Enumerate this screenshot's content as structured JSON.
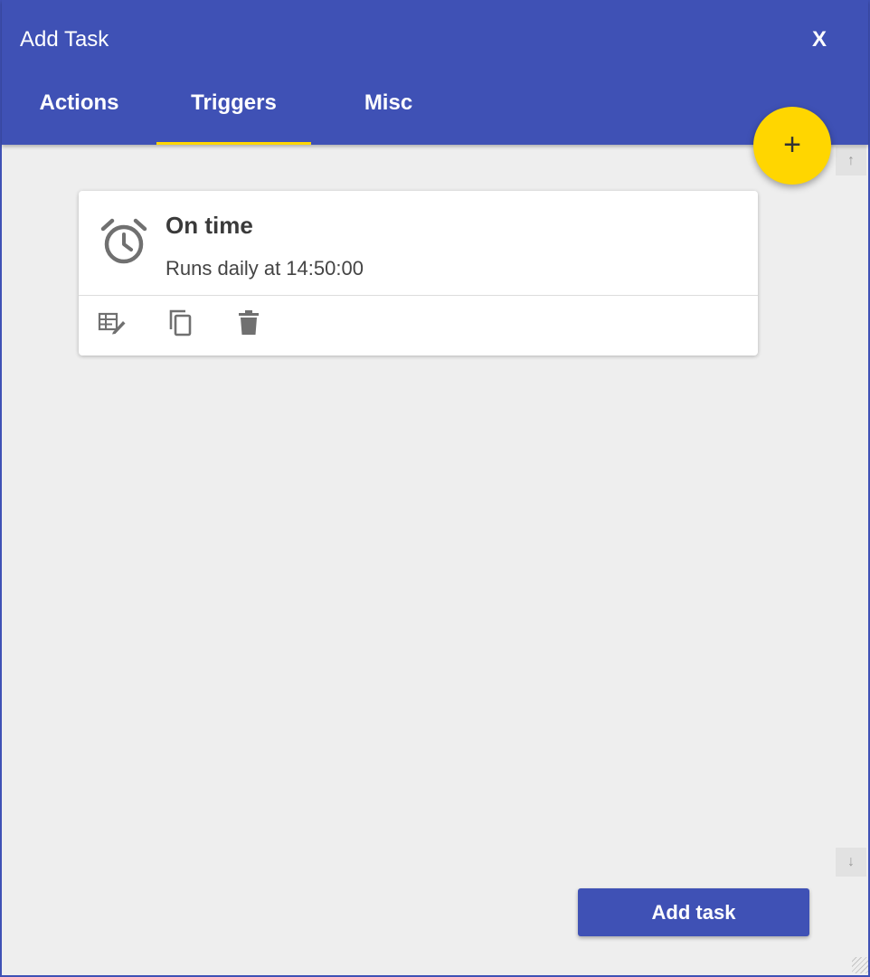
{
  "dialog": {
    "title": "Add Task",
    "close_label": "X"
  },
  "tabs": [
    {
      "label": "Actions",
      "active": false
    },
    {
      "label": "Triggers",
      "active": true
    },
    {
      "label": "Misc",
      "active": false
    }
  ],
  "fab": {
    "label": "+",
    "icon": "add-icon"
  },
  "triggers": [
    {
      "icon": "alarm-clock-icon",
      "title": "On time",
      "description": "Runs daily at 14:50:00",
      "actions": [
        "edit-icon",
        "copy-icon",
        "delete-icon"
      ]
    }
  ],
  "footer": {
    "add_task_label": "Add task"
  },
  "colors": {
    "primary": "#3f51b5",
    "accent": "#ffd600",
    "background": "#eeeeee",
    "card": "#ffffff"
  }
}
